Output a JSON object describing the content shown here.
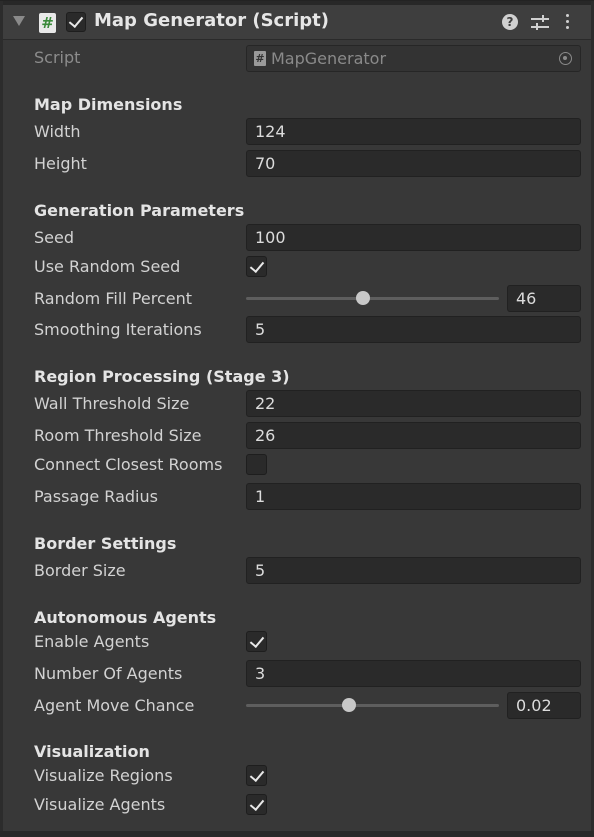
{
  "component": {
    "title": "Map Generator (Script)",
    "icon": "script-hash-icon",
    "enabled": true,
    "header_icons": [
      "help-icon",
      "presets-icon",
      "menu-icon"
    ]
  },
  "script": {
    "label": "Script",
    "value": "MapGenerator"
  },
  "sections": {
    "map_dimensions": {
      "title": "Map Dimensions",
      "width_label": "Width",
      "width_value": "124",
      "height_label": "Height",
      "height_value": "70"
    },
    "generation": {
      "title": "Generation Parameters",
      "seed_label": "Seed",
      "seed_value": "100",
      "random_seed_label": "Use Random Seed",
      "random_seed_checked": true,
      "fill_label": "Random Fill Percent",
      "fill_value": "46",
      "fill_min": 0,
      "fill_max": 100,
      "smoothing_label": "Smoothing Iterations",
      "smoothing_value": "5"
    },
    "region": {
      "title": "Region Processing (Stage 3)",
      "wall_label": "Wall Threshold Size",
      "wall_value": "22",
      "room_label": "Room Threshold Size",
      "room_value": "26",
      "connect_label": "Connect Closest Rooms",
      "connect_checked": false,
      "passage_label": "Passage Radius",
      "passage_value": "1"
    },
    "border": {
      "title": "Border Settings",
      "size_label": "Border Size",
      "size_value": "5"
    },
    "agents": {
      "title": "Autonomous Agents",
      "enable_label": "Enable Agents",
      "enable_checked": true,
      "count_label": "Number Of Agents",
      "count_value": "3",
      "chance_label": "Agent Move Chance",
      "chance_value": "0.02",
      "chance_min": 0,
      "chance_max": 0.05
    },
    "visualization": {
      "title": "Visualization",
      "regions_label": "Visualize Regions",
      "regions_checked": true,
      "agents_label": "Visualize Agents",
      "agents_checked": true
    }
  }
}
